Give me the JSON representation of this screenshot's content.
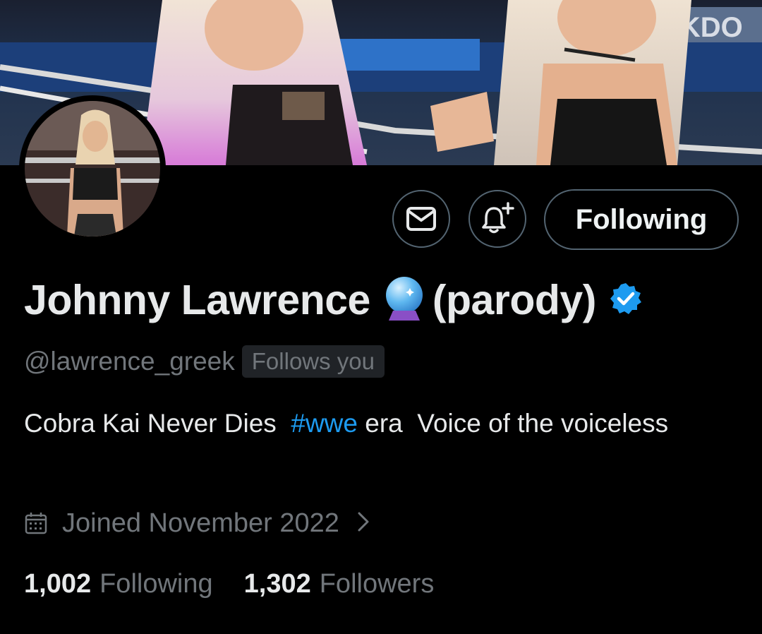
{
  "profile": {
    "name": "Johnny Lawrence",
    "name_suffix": "(parody)",
    "name_emoji": "crystal-ball",
    "verified": true,
    "handle": "@lawrence_greek",
    "follows_you_label": "Follows you",
    "bio": {
      "before": "Cobra Kai Never Dies  ",
      "hashtag": "#wwe",
      "after": " era  Voice of the voiceless"
    },
    "joined": "Joined November 2022"
  },
  "actions": {
    "message_icon": "envelope-icon",
    "notify_icon": "bell-plus-icon",
    "following_label": "Following"
  },
  "stats": {
    "following_count": "1,002",
    "following_label": "Following",
    "followers_count": "1,302",
    "followers_label": "Followers"
  },
  "colors": {
    "background": "#000000",
    "text_primary": "#e7e9ea",
    "text_secondary": "#71767b",
    "link": "#1d9bf0",
    "verified": "#1d9bf0",
    "border": "#536471"
  }
}
